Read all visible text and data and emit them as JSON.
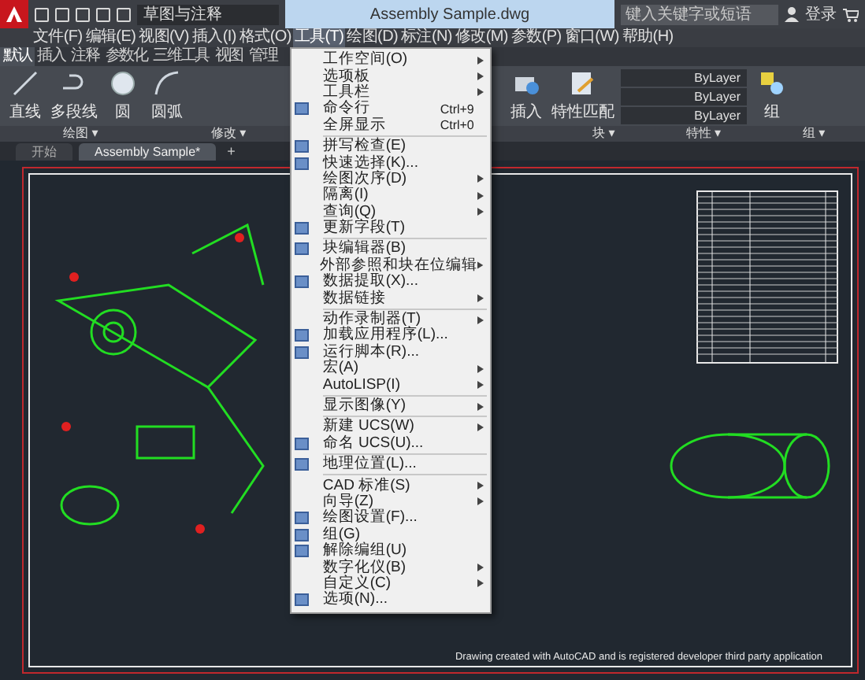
{
  "title_bar": {
    "workspace": "草图与注释",
    "title": "Assembly Sample.dwg",
    "search": {
      "placeholder": "键入关键字或短语"
    },
    "sign_in": "登录"
  },
  "menu_bar": [
    {
      "label": "文件(F)",
      "selected": false
    },
    {
      "label": "编辑(E)",
      "selected": false
    },
    {
      "label": "视图(V)",
      "selected": false
    },
    {
      "label": "插入(I)",
      "selected": false
    },
    {
      "label": "格式(O)",
      "selected": false
    },
    {
      "label": "工具(T)",
      "selected": true
    },
    {
      "label": "绘图(D)",
      "selected": false
    },
    {
      "label": "标注(N)",
      "selected": false
    },
    {
      "label": "修改(M)",
      "selected": false
    },
    {
      "label": "参数(P)",
      "selected": false
    },
    {
      "label": "窗口(W)",
      "selected": false
    },
    {
      "label": "帮助(H)",
      "selected": false
    }
  ],
  "ribbon": {
    "tabs": [
      {
        "label": "默认",
        "selected": true
      },
      {
        "label": "插入",
        "selected": false
      },
      {
        "label": "注释",
        "selected": false
      },
      {
        "label": "参数化",
        "selected": false
      },
      {
        "label": "三维工具",
        "selected": false
      },
      {
        "label": "视图",
        "selected": false
      },
      {
        "label": "管理",
        "selected": false
      }
    ],
    "draw_tools": [
      "直线",
      "多段线",
      "圆",
      "圆弧"
    ],
    "insert": "插入",
    "match": "特性匹配",
    "layers": [
      "ByLayer",
      "ByLayer",
      "ByLayer"
    ],
    "group": "组",
    "panels": [
      "绘图 ▾",
      "修改 ▾",
      "块 ▾",
      "特性 ▾",
      "组 ▾"
    ]
  },
  "doc_tabs": [
    {
      "label": "开始",
      "selected": false
    },
    {
      "label": "Assembly Sample*",
      "selected": true
    }
  ],
  "new_tab": "+",
  "tools_menu": [
    {
      "kind": "item",
      "label": "工作空间(O)",
      "submenu": true,
      "icon": false
    },
    {
      "kind": "item",
      "label": "选项板",
      "submenu": true,
      "icon": false
    },
    {
      "kind": "item",
      "label": "工具栏",
      "submenu": true,
      "icon": false
    },
    {
      "kind": "item",
      "label": "命令行",
      "shortcut": "Ctrl+9",
      "submenu": false,
      "icon": true
    },
    {
      "kind": "item",
      "label": "全屏显示",
      "shortcut": "Ctrl+0",
      "submenu": false,
      "icon": false
    },
    {
      "kind": "separator"
    },
    {
      "kind": "item",
      "label": "拼写检查(E)",
      "submenu": false,
      "icon": true
    },
    {
      "kind": "item",
      "label": "快速选择(K)...",
      "submenu": false,
      "icon": true
    },
    {
      "kind": "item",
      "label": "绘图次序(D)",
      "submenu": true,
      "icon": false
    },
    {
      "kind": "item",
      "label": "隔离(I)",
      "submenu": true,
      "icon": false
    },
    {
      "kind": "item",
      "label": "查询(Q)",
      "submenu": true,
      "icon": false
    },
    {
      "kind": "item",
      "label": "更新字段(T)",
      "submenu": false,
      "icon": true
    },
    {
      "kind": "separator"
    },
    {
      "kind": "item",
      "label": "块编辑器(B)",
      "submenu": false,
      "icon": true
    },
    {
      "kind": "item",
      "label": "外部参照和块在位编辑",
      "submenu": true,
      "icon": false
    },
    {
      "kind": "item",
      "label": "数据提取(X)...",
      "submenu": false,
      "icon": true
    },
    {
      "kind": "item",
      "label": "数据链接",
      "submenu": true,
      "icon": false
    },
    {
      "kind": "separator"
    },
    {
      "kind": "item",
      "label": "动作录制器(T)",
      "submenu": true,
      "icon": false
    },
    {
      "kind": "item",
      "label": "加载应用程序(L)...",
      "submenu": false,
      "icon": true
    },
    {
      "kind": "item",
      "label": "运行脚本(R)...",
      "submenu": false,
      "icon": true
    },
    {
      "kind": "item",
      "label": "宏(A)",
      "submenu": true,
      "icon": false
    },
    {
      "kind": "item",
      "label": "AutoLISP(I)",
      "submenu": true,
      "icon": false
    },
    {
      "kind": "separator"
    },
    {
      "kind": "item",
      "label": "显示图像(Y)",
      "submenu": true,
      "icon": false
    },
    {
      "kind": "separator"
    },
    {
      "kind": "item",
      "label": "新建 UCS(W)",
      "submenu": true,
      "icon": false
    },
    {
      "kind": "item",
      "label": "命名 UCS(U)...",
      "submenu": false,
      "icon": true
    },
    {
      "kind": "separator"
    },
    {
      "kind": "item",
      "label": "地理位置(L)...",
      "submenu": false,
      "icon": true
    },
    {
      "kind": "separator"
    },
    {
      "kind": "item",
      "label": "CAD 标准(S)",
      "submenu": true,
      "icon": false
    },
    {
      "kind": "item",
      "label": "向导(Z)",
      "submenu": true,
      "icon": false
    },
    {
      "kind": "item",
      "label": "绘图设置(F)...",
      "submenu": false,
      "icon": true
    },
    {
      "kind": "item",
      "label": "组(G)",
      "submenu": false,
      "icon": true
    },
    {
      "kind": "item",
      "label": "解除编组(U)",
      "submenu": false,
      "icon": true
    },
    {
      "kind": "item",
      "label": "数字化仪(B)",
      "submenu": true,
      "icon": false
    },
    {
      "kind": "item",
      "label": "自定义(C)",
      "submenu": true,
      "icon": false
    },
    {
      "kind": "item",
      "label": "选项(N)...",
      "submenu": false,
      "icon": true
    }
  ],
  "drawing": {
    "note": "Drawing created with AutoCAD and is registered developer third party application"
  }
}
